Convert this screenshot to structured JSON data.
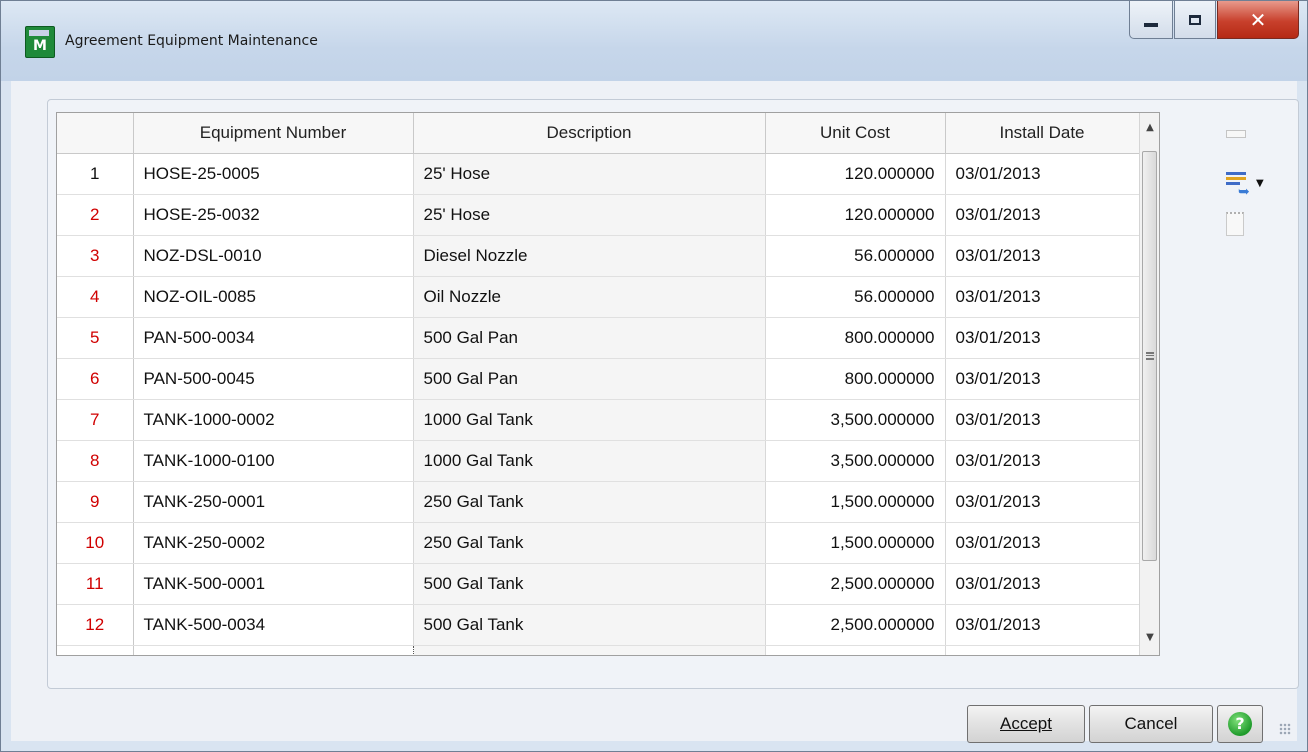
{
  "window": {
    "title": "Agreement Equipment Maintenance",
    "icon": "app-icon",
    "controls": [
      "minimize-icon",
      "maximize-icon",
      "close-icon"
    ]
  },
  "grid": {
    "columns": [
      "",
      "Equipment Number",
      "Description",
      "Unit Cost",
      "Install Date"
    ],
    "rows": [
      {
        "num": "1",
        "equipment": "HOSE-25-0005",
        "description": "25' Hose",
        "unit_cost": "120.000000",
        "install_date": "03/01/2013"
      },
      {
        "num": "2",
        "equipment": "HOSE-25-0032",
        "description": "25' Hose",
        "unit_cost": "120.000000",
        "install_date": "03/01/2013"
      },
      {
        "num": "3",
        "equipment": "NOZ-DSL-0010",
        "description": "Diesel Nozzle",
        "unit_cost": "56.000000",
        "install_date": "03/01/2013"
      },
      {
        "num": "4",
        "equipment": "NOZ-OIL-0085",
        "description": "Oil Nozzle",
        "unit_cost": "56.000000",
        "install_date": "03/01/2013"
      },
      {
        "num": "5",
        "equipment": "PAN-500-0034",
        "description": "500 Gal Pan",
        "unit_cost": "800.000000",
        "install_date": "03/01/2013"
      },
      {
        "num": "6",
        "equipment": "PAN-500-0045",
        "description": "500 Gal Pan",
        "unit_cost": "800.000000",
        "install_date": "03/01/2013"
      },
      {
        "num": "7",
        "equipment": "TANK-1000-0002",
        "description": "1000 Gal Tank",
        "unit_cost": "3,500.000000",
        "install_date": "03/01/2013"
      },
      {
        "num": "8",
        "equipment": "TANK-1000-0100",
        "description": "1000 Gal Tank",
        "unit_cost": "3,500.000000",
        "install_date": "03/01/2013"
      },
      {
        "num": "9",
        "equipment": "TANK-250-0001",
        "description": "250 Gal Tank",
        "unit_cost": "1,500.000000",
        "install_date": "03/01/2013"
      },
      {
        "num": "10",
        "equipment": "TANK-250-0002",
        "description": "250 Gal Tank",
        "unit_cost": "1,500.000000",
        "install_date": "03/01/2013"
      },
      {
        "num": "11",
        "equipment": "TANK-500-0001",
        "description": "500 Gal Tank",
        "unit_cost": "2,500.000000",
        "install_date": "03/01/2013"
      },
      {
        "num": "12",
        "equipment": "TANK-500-0034",
        "description": "500 Gal Tank",
        "unit_cost": "2,500.000000",
        "install_date": "03/01/2013"
      }
    ],
    "row_number_color": "#d00000"
  },
  "side_toolbar": {
    "icons": [
      "disabled-tool-icon",
      "lines-link-icon",
      "blank-page-icon"
    ]
  },
  "buttons": {
    "accept": "Accept",
    "cancel": "Cancel",
    "help_icon": "help-icon"
  },
  "colors": {
    "close_button": "#c8402c",
    "help_green": "#1f9b2b"
  }
}
